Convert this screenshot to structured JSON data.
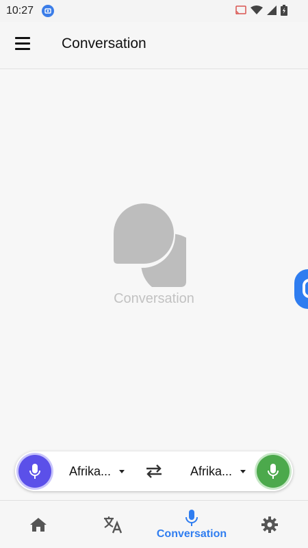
{
  "status_bar": {
    "time": "10:27",
    "icons": [
      "screenshot-badge-icon",
      "cast-icon",
      "wifi-icon",
      "signal-icon",
      "battery-charging-icon"
    ]
  },
  "app_bar": {
    "title": "Conversation",
    "menu_icon": "hamburger-menu-icon"
  },
  "empty_state": {
    "icon": "chat-bubbles-icon",
    "label": "Conversation"
  },
  "language_bar": {
    "left_language": "Afrika...",
    "right_language": "Afrika...",
    "left_mic_color": "#5b50e9",
    "right_mic_color": "#4ca94c",
    "swap_icon": "swap-arrows-icon"
  },
  "bottom_nav": {
    "items": [
      {
        "icon": "home-icon",
        "label": ""
      },
      {
        "icon": "translate-icon",
        "label": ""
      },
      {
        "icon": "microphone-icon",
        "label": "Conversation",
        "active": true
      },
      {
        "icon": "settings-gear-icon",
        "label": ""
      }
    ],
    "active_color": "#2f7df0"
  },
  "colors": {
    "accent": "#2f7df0",
    "background": "#f7f7f7"
  }
}
